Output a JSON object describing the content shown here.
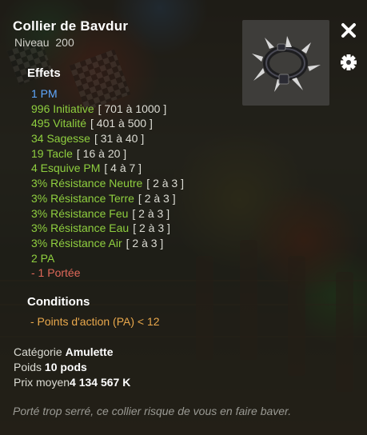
{
  "item": {
    "name": "Collier de Bavdur",
    "level_label": "Niveau",
    "level_value": "200"
  },
  "sections": {
    "effects_title": "Effets",
    "conditions_title": "Conditions"
  },
  "effects": [
    {
      "text": "1 PM",
      "range": "",
      "color": "#5fa8ff"
    },
    {
      "text": "996 Initiative",
      "range": "[ 701 à 1000 ]",
      "color": "#8fcf3f"
    },
    {
      "text": "495 Vitalité",
      "range": "[ 401 à 500 ]",
      "color": "#8fcf3f"
    },
    {
      "text": "34 Sagesse",
      "range": "[ 31 à 40 ]",
      "color": "#8fcf3f"
    },
    {
      "text": "19 Tacle",
      "range": "[ 16 à 20 ]",
      "color": "#8fcf3f"
    },
    {
      "text": "4 Esquive PM",
      "range": "[ 4 à 7 ]",
      "color": "#8fcf3f"
    },
    {
      "text": "3% Résistance Neutre",
      "range": "[ 2 à 3 ]",
      "color": "#8fcf3f"
    },
    {
      "text": "3% Résistance Terre",
      "range": "[ 2 à 3 ]",
      "color": "#8fcf3f"
    },
    {
      "text": "3% Résistance Feu",
      "range": "[ 2 à 3 ]",
      "color": "#8fcf3f"
    },
    {
      "text": "3% Résistance Eau",
      "range": "[ 2 à 3 ]",
      "color": "#8fcf3f"
    },
    {
      "text": "3% Résistance Air",
      "range": "[ 2 à 3 ]",
      "color": "#8fcf3f"
    },
    {
      "text": "2 PA",
      "range": "",
      "color": "#8fcf3f"
    },
    {
      "text": "- 1 Portée",
      "range": "",
      "color": "#e0685a"
    }
  ],
  "conditions": [
    {
      "text": "- Points d'action (PA) < 12"
    }
  ],
  "info": {
    "category_label": "Catégorie",
    "category_value": "Amulette",
    "weight_label": "Poids",
    "weight_value": "10 pods",
    "price_label": "Prix moyen",
    "price_value": "4 134 567 K"
  },
  "description": "Porté trop serré, ce collier risque de vous en faire baver.",
  "icons": {
    "close": "close-icon",
    "settings": "gear-icon",
    "item": "spiked-collar-icon"
  }
}
